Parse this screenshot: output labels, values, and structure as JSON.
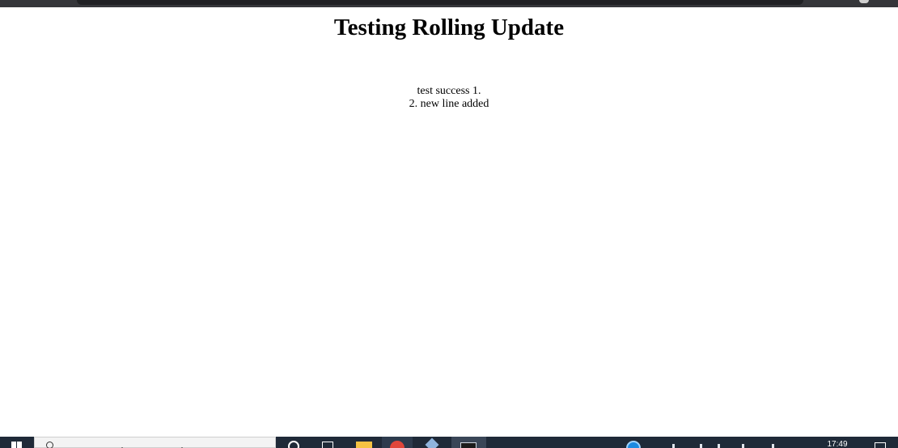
{
  "page": {
    "heading": "Testing Rolling Update",
    "lines": [
      "test success 1.",
      "2. new line added"
    ]
  },
  "taskbar": {
    "clock_time": "17:49",
    "pinned": [
      {
        "name": "cortana",
        "icon": "circle-icon"
      },
      {
        "name": "task-view",
        "icon": "task-view-icon"
      },
      {
        "name": "file-explorer",
        "icon": "folder-icon"
      },
      {
        "name": "chrome",
        "icon": "chrome-icon",
        "active": true
      },
      {
        "name": "virtualbox",
        "icon": "virtualbox-icon"
      },
      {
        "name": "terminal",
        "icon": "terminal-icon",
        "active": true
      }
    ]
  },
  "colors": {
    "taskbar_bg": "#1f2a38",
    "page_bg": "#ffffff",
    "browser_frame": "#35363a"
  }
}
